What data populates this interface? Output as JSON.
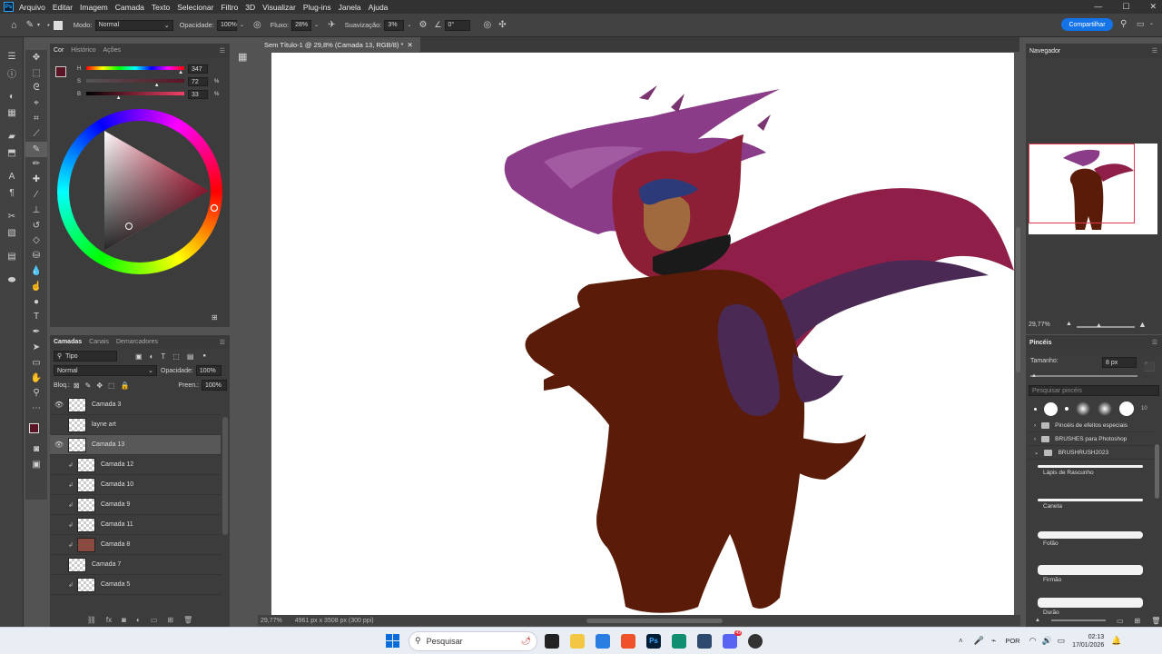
{
  "menu": [
    "Arquivo",
    "Editar",
    "Imagem",
    "Camada",
    "Texto",
    "Selecionar",
    "Filtro",
    "3D",
    "Visualizar",
    "Plug-ins",
    "Janela",
    "Ajuda"
  ],
  "options": {
    "mode_label": "Modo:",
    "mode_value": "Normal",
    "opacity_label": "Opacidade:",
    "opacity_value": "100%",
    "flow_label": "Fluxo:",
    "flow_value": "28%",
    "smoothing_label": "Suavização:",
    "smoothing_value": "3%",
    "angle_value": "0°",
    "share_label": "Compartilhar"
  },
  "color_panel": {
    "tabs": [
      "Cor",
      "Histórico",
      "Ações"
    ],
    "h_label": "H",
    "h_value": "347",
    "h_level": 0.964,
    "s_label": "S",
    "s_value": "72",
    "s_unit": "%",
    "s_level": 0.72,
    "b_label": "B",
    "b_value": "33",
    "b_unit": "%",
    "b_level": 0.33,
    "foreground": "#5a1424"
  },
  "document": {
    "tab_title": "Sem Título-1 @ 29,8% (Camada 13, RGB/8) *",
    "zoom": "29,77%",
    "size_info": "4961 px x 3508 px (300 ppi)"
  },
  "layers_panel": {
    "tabs": [
      "Camadas",
      "Canais",
      "Demarcadores"
    ],
    "filter_label": "Tipo",
    "blend_mode": "Normal",
    "opacity_label": "Opacidade:",
    "opacity_value": "100%",
    "lock_label": "Bloq.:",
    "fill_label": "Preen.:",
    "fill_value": "100%",
    "layers": [
      {
        "name": "Camada 3",
        "visible": true,
        "clipped": false
      },
      {
        "name": "layne art",
        "visible": false,
        "clipped": false
      },
      {
        "name": "Camada 13",
        "visible": true,
        "clipped": false,
        "selected": true
      },
      {
        "name": "Camada 12",
        "visible": false,
        "clipped": true
      },
      {
        "name": "Camada 10",
        "visible": false,
        "clipped": true
      },
      {
        "name": "Camada 9",
        "visible": false,
        "clipped": true
      },
      {
        "name": "Camada 11",
        "visible": false,
        "clipped": true
      },
      {
        "name": "Camada 8",
        "visible": false,
        "clipped": true,
        "swatch": "#8a4a42"
      },
      {
        "name": "Camada 7",
        "visible": false,
        "clipped": false
      },
      {
        "name": "Camada 5",
        "visible": false,
        "clipped": true
      }
    ]
  },
  "navigator": {
    "title": "Navegador",
    "zoom": "29,77%"
  },
  "brushes": {
    "title": "Pincéis",
    "size_label": "Tamanho:",
    "size_value": "8 px",
    "search_placeholder": "Pesquisar pincéis",
    "preset_count": "10",
    "folders": [
      "Pincéis de efeitos especiais",
      "BRUSHES para Photoshop",
      "BRUSHRUSH2023"
    ],
    "items": [
      "Lápis de Rascunho",
      "Caneta",
      "Fofão",
      "Firmão",
      "Durão"
    ]
  },
  "taskbar": {
    "search_placeholder": "Pesquisar",
    "lang": "POR",
    "time": "02:13",
    "date": "17/01/2026",
    "discord_badge": "49"
  }
}
